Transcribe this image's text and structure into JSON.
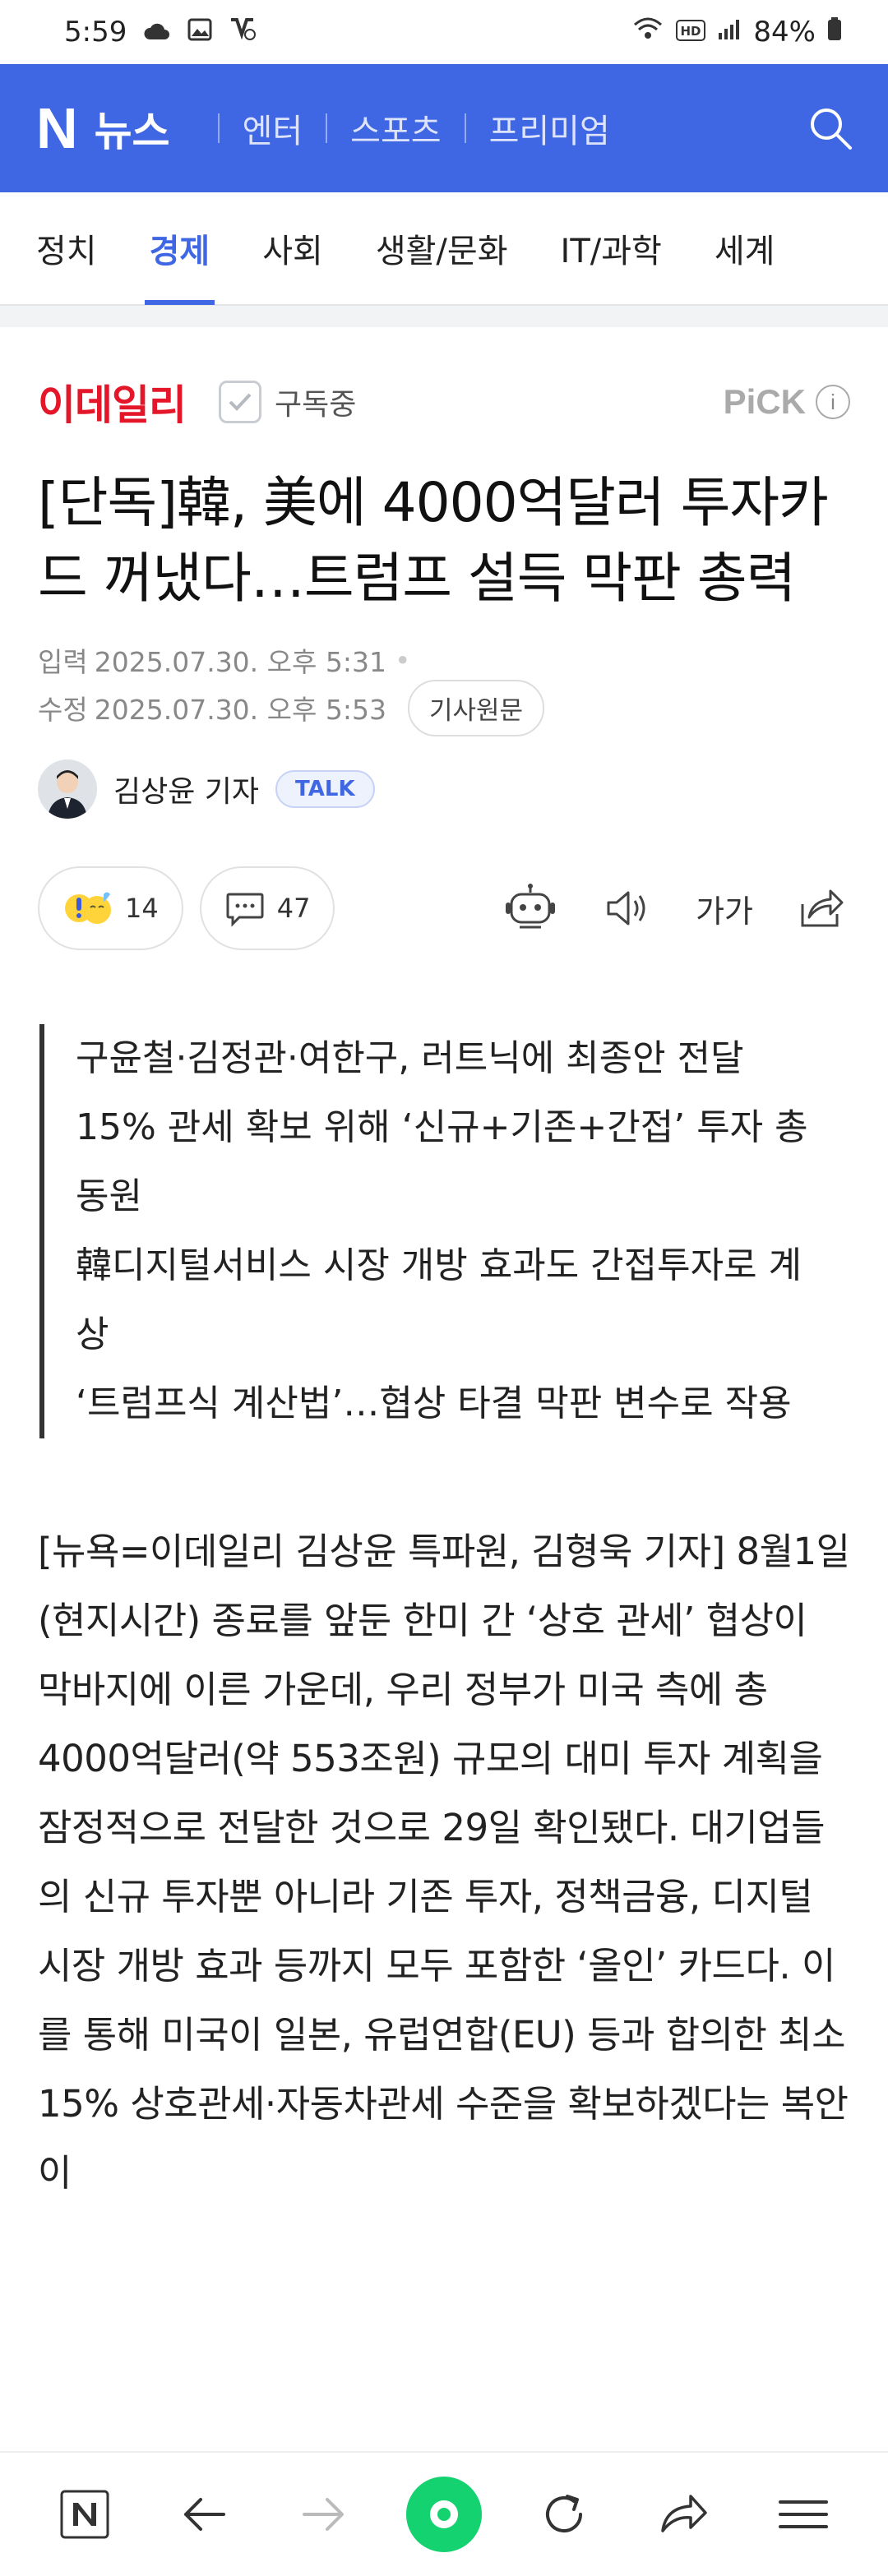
{
  "status_bar": {
    "time": "5:59",
    "battery": "84%"
  },
  "header": {
    "logo_n": "N",
    "logo_news": "뉴스",
    "tabs": [
      {
        "label": "엔터"
      },
      {
        "label": "스포츠"
      },
      {
        "label": "프리미엄"
      }
    ]
  },
  "categories": [
    {
      "label": "정치"
    },
    {
      "label": "경제"
    },
    {
      "label": "사회"
    },
    {
      "label": "생활/문화"
    },
    {
      "label": "IT/과학"
    },
    {
      "label": "세계"
    }
  ],
  "active_category": "경제",
  "press": {
    "name": "이데일리",
    "subscribe_label": "구독중",
    "pick_label": "PiCK",
    "info_label": "i"
  },
  "article": {
    "title": "[단독]韓, 美에 4000억달러 투자카드 꺼냈다…트럼프 설득 막판 총력",
    "published_label": "입력",
    "published": "2025.07.30. 오후 5:31",
    "modified_label": "수정",
    "modified": "2025.07.30. 오후 5:53",
    "original_button": "기사원문",
    "reporter": "김상윤 기자",
    "talk_label": "TALK",
    "reaction_count": "14",
    "comment_count": "47",
    "font_size_label": "가가",
    "summary": [
      "구윤철·김정관·여한구, 러트닉에 최종안 전달",
      "15% 관세 확보 위해 ‘신규+기존+간접’ 투자 총동원",
      "韓디지털서비스 시장 개방 효과도 간접투자로 계상",
      "‘트럼프식 계산법’…협상 타결 막판 변수로 작용"
    ],
    "body": "[뉴욕=이데일리 김상윤 특파원, 김형욱 기자] 8월1일(현지시간) 종료를 앞둔 한미 간 ‘상호 관세’ 협상이 막바지에 이른 가운데, 우리 정부가 미국 측에 총 4000억달러(약 553조원) 규모의 대미 투자 계획을 잠정적으로 전달한 것으로 29일 확인됐다. 대기업들의 신규 투자뿐 아니라 기존 투자, 정책금융, 디지털 시장 개방 효과 등까지 모두 포함한 ‘올인’ 카드다. 이를 통해 미국이 일본, 유럽연합(EU) 등과 합의한 최소 15% 상호관세·자동차관세 수준을 확보하겠다는 복안이"
  },
  "colors": {
    "brand": "#3f67e4",
    "press_red": "#e3162a",
    "green": "#13d26f"
  }
}
